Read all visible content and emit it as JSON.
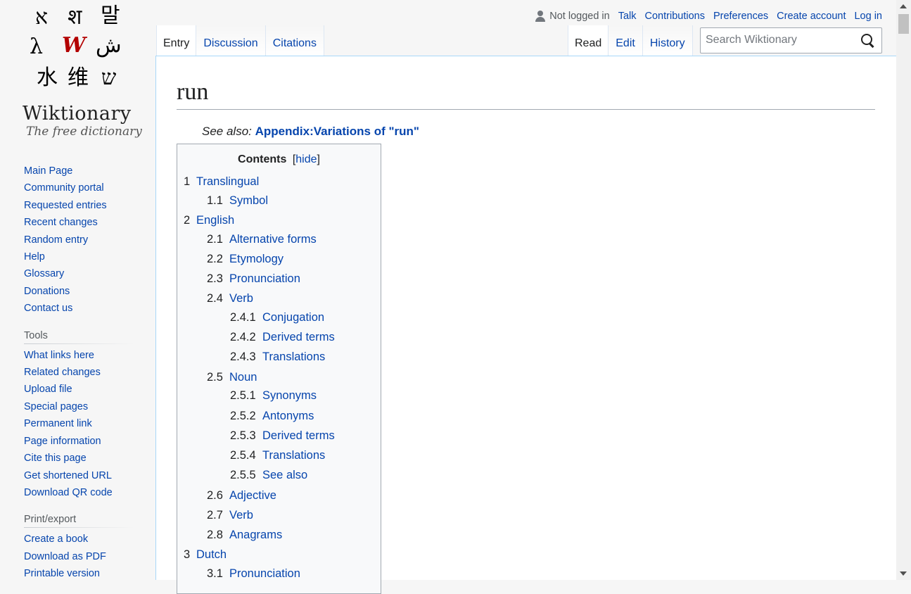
{
  "logo": {
    "glyphs": [
      "ﬡ",
      "श",
      "말",
      "λ",
      "W",
      "ش",
      "水",
      "维",
      "ש"
    ],
    "wordmark": "Wiktionary",
    "tagline": "The free dictionary"
  },
  "sidebar": {
    "navigation": [
      "Main Page",
      "Community portal",
      "Requested entries",
      "Recent changes",
      "Random entry",
      "Help",
      "Glossary",
      "Donations",
      "Contact us"
    ],
    "tools_heading": "Tools",
    "tools": [
      "What links here",
      "Related changes",
      "Upload file",
      "Special pages",
      "Permanent link",
      "Page information",
      "Cite this page",
      "Get shortened URL",
      "Download QR code"
    ],
    "print_heading": "Print/export",
    "print": [
      "Create a book",
      "Download as PDF",
      "Printable version"
    ]
  },
  "personal": {
    "status": "Not logged in",
    "links": [
      "Talk",
      "Contributions",
      "Preferences",
      "Create account",
      "Log in"
    ]
  },
  "tabs": {
    "left": [
      "Entry",
      "Discussion",
      "Citations"
    ],
    "right": [
      "Read",
      "Edit",
      "History"
    ]
  },
  "search": {
    "placeholder": "Search Wiktionary",
    "value": ""
  },
  "page": {
    "title": "run",
    "see_also_prefix": "See also:",
    "see_also_link": "Appendix:Variations of \"run\""
  },
  "toc": {
    "title": "Contents",
    "hide_open": "[",
    "hide": "hide",
    "hide_close": "]",
    "items": [
      {
        "num": "1",
        "label": "Translingual",
        "level": 1
      },
      {
        "num": "1.1",
        "label": "Symbol",
        "level": 2
      },
      {
        "num": "2",
        "label": "English",
        "level": 1
      },
      {
        "num": "2.1",
        "label": "Alternative forms",
        "level": 2
      },
      {
        "num": "2.2",
        "label": "Etymology",
        "level": 2
      },
      {
        "num": "2.3",
        "label": "Pronunciation",
        "level": 2
      },
      {
        "num": "2.4",
        "label": "Verb",
        "level": 2
      },
      {
        "num": "2.4.1",
        "label": "Conjugation",
        "level": 3
      },
      {
        "num": "2.4.2",
        "label": "Derived terms",
        "level": 3
      },
      {
        "num": "2.4.3",
        "label": "Translations",
        "level": 3
      },
      {
        "num": "2.5",
        "label": "Noun",
        "level": 2
      },
      {
        "num": "2.5.1",
        "label": "Synonyms",
        "level": 3
      },
      {
        "num": "2.5.2",
        "label": "Antonyms",
        "level": 3
      },
      {
        "num": "2.5.3",
        "label": "Derived terms",
        "level": 3
      },
      {
        "num": "2.5.4",
        "label": "Translations",
        "level": 3
      },
      {
        "num": "2.5.5",
        "label": "See also",
        "level": 3
      },
      {
        "num": "2.6",
        "label": "Adjective",
        "level": 2
      },
      {
        "num": "2.7",
        "label": "Verb",
        "level": 2
      },
      {
        "num": "2.8",
        "label": "Anagrams",
        "level": 2
      },
      {
        "num": "3",
        "label": "Dutch",
        "level": 1
      },
      {
        "num": "3.1",
        "label": "Pronunciation",
        "level": 2
      }
    ]
  },
  "colors": {
    "link": "#0645ad",
    "text": "#202122",
    "border": "#a7d7f9",
    "sidebar_bg": "#f6f6f6"
  }
}
